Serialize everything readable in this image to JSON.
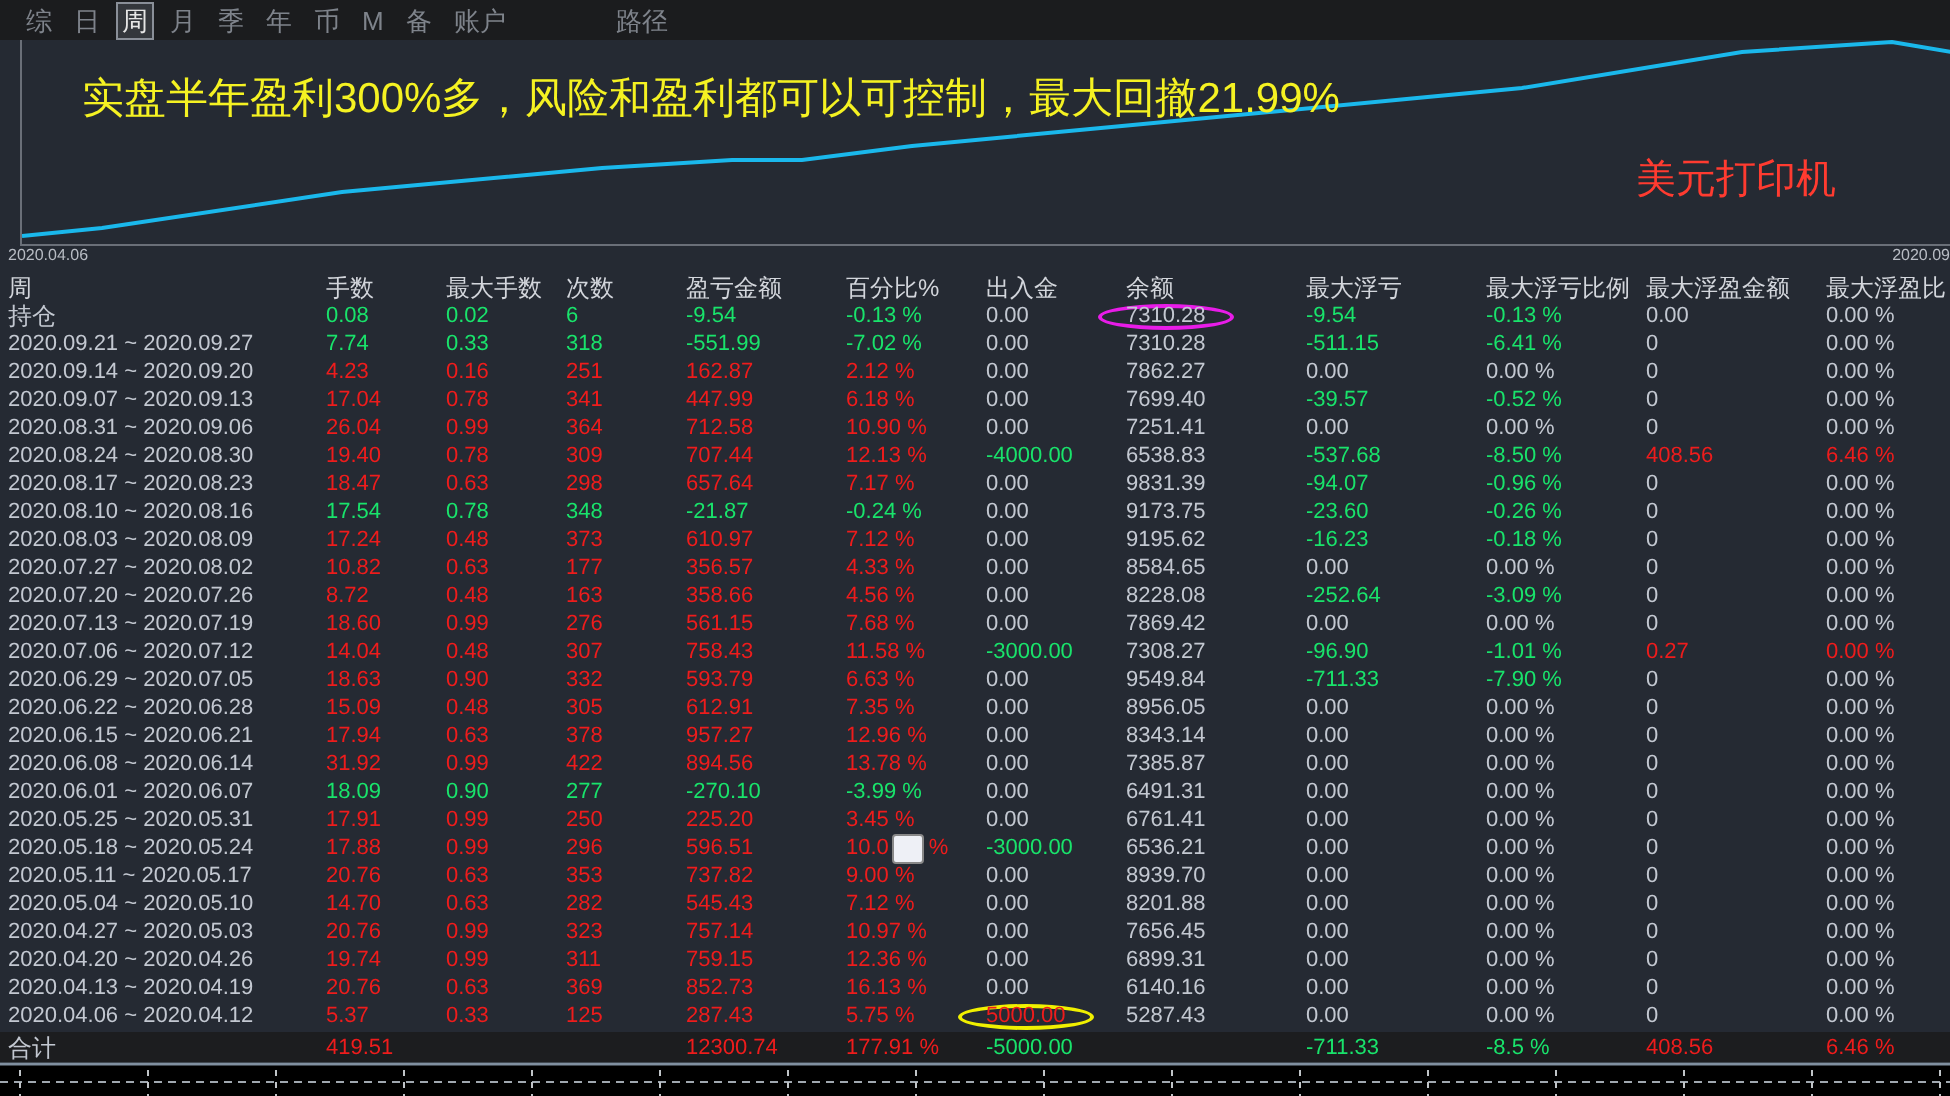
{
  "tabs": [
    {
      "label": "综",
      "selected": false
    },
    {
      "label": "日",
      "selected": false
    },
    {
      "label": "周",
      "selected": true
    },
    {
      "label": "月",
      "selected": false
    },
    {
      "label": "季",
      "selected": false
    },
    {
      "label": "年",
      "selected": false
    },
    {
      "label": "币",
      "selected": false
    },
    {
      "label": "M",
      "selected": false
    },
    {
      "label": "备",
      "selected": false
    },
    {
      "label": "账户",
      "selected": false
    },
    {
      "label": "路径",
      "selected": false
    }
  ],
  "chart": {
    "headline": "实盘半年盈利300%多，风险和盈利都可以可控制，最大回撤21.99%",
    "caption": "美元打印机",
    "start_date": "2020.04.06",
    "end_date": "2020.09"
  },
  "table": {
    "columns": [
      "周",
      "手数",
      "最大手数",
      "次数",
      "盈亏金额",
      "百分比%",
      "出入金",
      "余额",
      "最大浮亏",
      "最大浮亏比例",
      "最大浮盈金额",
      "最大浮盈比"
    ],
    "rows": [
      {
        "cells": [
          {
            "text": "持仓"
          },
          {
            "text": "0.08",
            "color": "#19e36b"
          },
          {
            "text": "0.02",
            "color": "#19e36b"
          },
          {
            "text": "6",
            "color": "#19e36b"
          },
          {
            "text": "-9.54",
            "color": "#19e36b"
          },
          {
            "text": "-0.13 %",
            "color": "#19e36b"
          },
          {
            "text": "0.00"
          },
          {
            "text": "7310.28",
            "annotation": {
              "color": "#e81ce8"
            }
          },
          {
            "text": "-9.54",
            "color": "#19e36b"
          },
          {
            "text": "-0.13 %",
            "color": "#19e36b"
          },
          {
            "text": "0.00"
          },
          {
            "text": "0.00 %"
          }
        ]
      },
      {
        "cells": [
          {
            "text": "2020.09.21 ~ 2020.09.27"
          },
          {
            "text": "7.74",
            "color": "#19e36b"
          },
          {
            "text": "0.33",
            "color": "#19e36b"
          },
          {
            "text": "318",
            "color": "#19e36b"
          },
          {
            "text": "-551.99",
            "color": "#19e36b"
          },
          {
            "text": "-7.02 %",
            "color": "#19e36b"
          },
          {
            "text": "0.00"
          },
          {
            "text": "7310.28"
          },
          {
            "text": "-511.15",
            "color": "#19e36b"
          },
          {
            "text": "-6.41 %",
            "color": "#19e36b"
          },
          {
            "text": "0"
          },
          {
            "text": "0.00 %"
          }
        ]
      },
      {
        "cells": [
          {
            "text": "2020.09.14 ~ 2020.09.20"
          },
          {
            "text": "4.23",
            "color": "#ee1c1c"
          },
          {
            "text": "0.16",
            "color": "#ee1c1c"
          },
          {
            "text": "251",
            "color": "#ee1c1c"
          },
          {
            "text": "162.87",
            "color": "#ee1c1c"
          },
          {
            "text": "2.12 %",
            "color": "#ee1c1c"
          },
          {
            "text": "0.00"
          },
          {
            "text": "7862.27"
          },
          {
            "text": "0.00"
          },
          {
            "text": "0.00 %"
          },
          {
            "text": "0"
          },
          {
            "text": "0.00 %"
          }
        ]
      },
      {
        "cells": [
          {
            "text": "2020.09.07 ~ 2020.09.13"
          },
          {
            "text": "17.04",
            "color": "#ee1c1c"
          },
          {
            "text": "0.78",
            "color": "#ee1c1c"
          },
          {
            "text": "341",
            "color": "#ee1c1c"
          },
          {
            "text": "447.99",
            "color": "#ee1c1c"
          },
          {
            "text": "6.18 %",
            "color": "#ee1c1c"
          },
          {
            "text": "0.00"
          },
          {
            "text": "7699.40"
          },
          {
            "text": "-39.57",
            "color": "#19e36b"
          },
          {
            "text": "-0.52 %",
            "color": "#19e36b"
          },
          {
            "text": "0"
          },
          {
            "text": "0.00 %"
          }
        ]
      },
      {
        "cells": [
          {
            "text": "2020.08.31 ~ 2020.09.06"
          },
          {
            "text": "26.04",
            "color": "#ee1c1c"
          },
          {
            "text": "0.99",
            "color": "#ee1c1c"
          },
          {
            "text": "364",
            "color": "#ee1c1c"
          },
          {
            "text": "712.58",
            "color": "#ee1c1c"
          },
          {
            "text": "10.90 %",
            "color": "#ee1c1c"
          },
          {
            "text": "0.00"
          },
          {
            "text": "7251.41"
          },
          {
            "text": "0.00"
          },
          {
            "text": "0.00 %"
          },
          {
            "text": "0"
          },
          {
            "text": "0.00 %"
          }
        ]
      },
      {
        "cells": [
          {
            "text": "2020.08.24 ~ 2020.08.30"
          },
          {
            "text": "19.40",
            "color": "#ee1c1c"
          },
          {
            "text": "0.78",
            "color": "#ee1c1c"
          },
          {
            "text": "309",
            "color": "#ee1c1c"
          },
          {
            "text": "707.44",
            "color": "#ee1c1c"
          },
          {
            "text": "12.13 %",
            "color": "#ee1c1c"
          },
          {
            "text": "-4000.00",
            "color": "#19e36b"
          },
          {
            "text": "6538.83"
          },
          {
            "text": "-537.68",
            "color": "#19e36b"
          },
          {
            "text": "-8.50 %",
            "color": "#19e36b"
          },
          {
            "text": "408.56",
            "color": "#ee1c1c"
          },
          {
            "text": "6.46 %",
            "color": "#ee1c1c"
          }
        ]
      },
      {
        "cells": [
          {
            "text": "2020.08.17 ~ 2020.08.23"
          },
          {
            "text": "18.47",
            "color": "#ee1c1c"
          },
          {
            "text": "0.63",
            "color": "#ee1c1c"
          },
          {
            "text": "298",
            "color": "#ee1c1c"
          },
          {
            "text": "657.64",
            "color": "#ee1c1c"
          },
          {
            "text": "7.17 %",
            "color": "#ee1c1c"
          },
          {
            "text": "0.00"
          },
          {
            "text": "9831.39"
          },
          {
            "text": "-94.07",
            "color": "#19e36b"
          },
          {
            "text": "-0.96 %",
            "color": "#19e36b"
          },
          {
            "text": "0"
          },
          {
            "text": "0.00 %"
          }
        ]
      },
      {
        "cells": [
          {
            "text": "2020.08.10 ~ 2020.08.16"
          },
          {
            "text": "17.54",
            "color": "#19e36b"
          },
          {
            "text": "0.78",
            "color": "#19e36b"
          },
          {
            "text": "348",
            "color": "#19e36b"
          },
          {
            "text": "-21.87",
            "color": "#19e36b"
          },
          {
            "text": "-0.24 %",
            "color": "#19e36b"
          },
          {
            "text": "0.00"
          },
          {
            "text": "9173.75"
          },
          {
            "text": "-23.60",
            "color": "#19e36b"
          },
          {
            "text": "-0.26 %",
            "color": "#19e36b"
          },
          {
            "text": "0"
          },
          {
            "text": "0.00 %"
          }
        ]
      },
      {
        "cells": [
          {
            "text": "2020.08.03 ~ 2020.08.09"
          },
          {
            "text": "17.24",
            "color": "#ee1c1c"
          },
          {
            "text": "0.48",
            "color": "#ee1c1c"
          },
          {
            "text": "373",
            "color": "#ee1c1c"
          },
          {
            "text": "610.97",
            "color": "#ee1c1c"
          },
          {
            "text": "7.12 %",
            "color": "#ee1c1c"
          },
          {
            "text": "0.00"
          },
          {
            "text": "9195.62"
          },
          {
            "text": "-16.23",
            "color": "#19e36b"
          },
          {
            "text": "-0.18 %",
            "color": "#19e36b"
          },
          {
            "text": "0"
          },
          {
            "text": "0.00 %"
          }
        ]
      },
      {
        "cells": [
          {
            "text": "2020.07.27 ~ 2020.08.02"
          },
          {
            "text": "10.82",
            "color": "#ee1c1c"
          },
          {
            "text": "0.63",
            "color": "#ee1c1c"
          },
          {
            "text": "177",
            "color": "#ee1c1c"
          },
          {
            "text": "356.57",
            "color": "#ee1c1c"
          },
          {
            "text": "4.33 %",
            "color": "#ee1c1c"
          },
          {
            "text": "0.00"
          },
          {
            "text": "8584.65"
          },
          {
            "text": "0.00"
          },
          {
            "text": "0.00 %"
          },
          {
            "text": "0"
          },
          {
            "text": "0.00 %"
          }
        ]
      },
      {
        "cells": [
          {
            "text": "2020.07.20 ~ 2020.07.26"
          },
          {
            "text": "8.72",
            "color": "#ee1c1c"
          },
          {
            "text": "0.48",
            "color": "#ee1c1c"
          },
          {
            "text": "163",
            "color": "#ee1c1c"
          },
          {
            "text": "358.66",
            "color": "#ee1c1c"
          },
          {
            "text": "4.56 %",
            "color": "#ee1c1c"
          },
          {
            "text": "0.00"
          },
          {
            "text": "8228.08"
          },
          {
            "text": "-252.64",
            "color": "#19e36b"
          },
          {
            "text": "-3.09 %",
            "color": "#19e36b"
          },
          {
            "text": "0"
          },
          {
            "text": "0.00 %"
          }
        ]
      },
      {
        "cells": [
          {
            "text": "2020.07.13 ~ 2020.07.19"
          },
          {
            "text": "18.60",
            "color": "#ee1c1c"
          },
          {
            "text": "0.99",
            "color": "#ee1c1c"
          },
          {
            "text": "276",
            "color": "#ee1c1c"
          },
          {
            "text": "561.15",
            "color": "#ee1c1c"
          },
          {
            "text": "7.68 %",
            "color": "#ee1c1c"
          },
          {
            "text": "0.00"
          },
          {
            "text": "7869.42"
          },
          {
            "text": "0.00"
          },
          {
            "text": "0.00 %"
          },
          {
            "text": "0"
          },
          {
            "text": "0.00 %"
          }
        ]
      },
      {
        "cells": [
          {
            "text": "2020.07.06 ~ 2020.07.12"
          },
          {
            "text": "14.04",
            "color": "#ee1c1c"
          },
          {
            "text": "0.48",
            "color": "#ee1c1c"
          },
          {
            "text": "307",
            "color": "#ee1c1c"
          },
          {
            "text": "758.43",
            "color": "#ee1c1c"
          },
          {
            "text": "11.58 %",
            "color": "#ee1c1c"
          },
          {
            "text": "-3000.00",
            "color": "#19e36b"
          },
          {
            "text": "7308.27"
          },
          {
            "text": "-96.90",
            "color": "#19e36b"
          },
          {
            "text": "-1.01 %",
            "color": "#19e36b"
          },
          {
            "text": "0.27",
            "color": "#ee1c1c"
          },
          {
            "text": "0.00 %",
            "color": "#ee1c1c"
          }
        ]
      },
      {
        "cells": [
          {
            "text": "2020.06.29 ~ 2020.07.05"
          },
          {
            "text": "18.63",
            "color": "#ee1c1c"
          },
          {
            "text": "0.90",
            "color": "#ee1c1c"
          },
          {
            "text": "332",
            "color": "#ee1c1c"
          },
          {
            "text": "593.79",
            "color": "#ee1c1c"
          },
          {
            "text": "6.63 %",
            "color": "#ee1c1c"
          },
          {
            "text": "0.00"
          },
          {
            "text": "9549.84"
          },
          {
            "text": "-711.33",
            "color": "#19e36b"
          },
          {
            "text": "-7.90 %",
            "color": "#19e36b"
          },
          {
            "text": "0"
          },
          {
            "text": "0.00 %"
          }
        ]
      },
      {
        "cells": [
          {
            "text": "2020.06.22 ~ 2020.06.28"
          },
          {
            "text": "15.09",
            "color": "#ee1c1c"
          },
          {
            "text": "0.48",
            "color": "#ee1c1c"
          },
          {
            "text": "305",
            "color": "#ee1c1c"
          },
          {
            "text": "612.91",
            "color": "#ee1c1c"
          },
          {
            "text": "7.35 %",
            "color": "#ee1c1c"
          },
          {
            "text": "0.00"
          },
          {
            "text": "8956.05"
          },
          {
            "text": "0.00"
          },
          {
            "text": "0.00 %"
          },
          {
            "text": "0"
          },
          {
            "text": "0.00 %"
          }
        ]
      },
      {
        "cells": [
          {
            "text": "2020.06.15 ~ 2020.06.21"
          },
          {
            "text": "17.94",
            "color": "#ee1c1c"
          },
          {
            "text": "0.63",
            "color": "#ee1c1c"
          },
          {
            "text": "378",
            "color": "#ee1c1c"
          },
          {
            "text": "957.27",
            "color": "#ee1c1c"
          },
          {
            "text": "12.96 %",
            "color": "#ee1c1c"
          },
          {
            "text": "0.00"
          },
          {
            "text": "8343.14"
          },
          {
            "text": "0.00"
          },
          {
            "text": "0.00 %"
          },
          {
            "text": "0"
          },
          {
            "text": "0.00 %"
          }
        ]
      },
      {
        "cells": [
          {
            "text": "2020.06.08 ~ 2020.06.14"
          },
          {
            "text": "31.92",
            "color": "#ee1c1c"
          },
          {
            "text": "0.99",
            "color": "#ee1c1c"
          },
          {
            "text": "422",
            "color": "#ee1c1c"
          },
          {
            "text": "894.56",
            "color": "#ee1c1c"
          },
          {
            "text": "13.78 %",
            "color": "#ee1c1c"
          },
          {
            "text": "0.00"
          },
          {
            "text": "7385.87"
          },
          {
            "text": "0.00"
          },
          {
            "text": "0.00 %"
          },
          {
            "text": "0"
          },
          {
            "text": "0.00 %"
          }
        ]
      },
      {
        "cells": [
          {
            "text": "2020.06.01 ~ 2020.06.07"
          },
          {
            "text": "18.09",
            "color": "#19e36b"
          },
          {
            "text": "0.90",
            "color": "#19e36b"
          },
          {
            "text": "277",
            "color": "#19e36b"
          },
          {
            "text": "-270.10",
            "color": "#19e36b"
          },
          {
            "text": "-3.99 %",
            "color": "#19e36b"
          },
          {
            "text": "0.00"
          },
          {
            "text": "6491.31"
          },
          {
            "text": "0.00"
          },
          {
            "text": "0.00 %"
          },
          {
            "text": "0"
          },
          {
            "text": "0.00 %"
          }
        ]
      },
      {
        "cells": [
          {
            "text": "2020.05.25 ~ 2020.05.31"
          },
          {
            "text": "17.91",
            "color": "#ee1c1c"
          },
          {
            "text": "0.99",
            "color": "#ee1c1c"
          },
          {
            "text": "250",
            "color": "#ee1c1c"
          },
          {
            "text": "225.20",
            "color": "#ee1c1c"
          },
          {
            "text": "3.45 %",
            "color": "#ee1c1c"
          },
          {
            "text": "0.00"
          },
          {
            "text": "6761.41"
          },
          {
            "text": "0.00"
          },
          {
            "text": "0.00 %"
          },
          {
            "text": "0"
          },
          {
            "text": "0.00 %"
          }
        ]
      },
      {
        "cells": [
          {
            "text": "2020.05.18 ~ 2020.05.24"
          },
          {
            "text": "17.88",
            "color": "#ee1c1c"
          },
          {
            "text": "0.99",
            "color": "#ee1c1c"
          },
          {
            "text": "296",
            "color": "#ee1c1c"
          },
          {
            "text": "596.51",
            "color": "#ee1c1c"
          },
          {
            "text": "10.0",
            "tail": "%",
            "color": "#ee1c1c"
          },
          {
            "text": "-3000.00",
            "color": "#19e36b"
          },
          {
            "text": "6536.21"
          },
          {
            "text": "0.00"
          },
          {
            "text": "0.00 %"
          },
          {
            "text": "0"
          },
          {
            "text": "0.00 %"
          }
        ]
      },
      {
        "cells": [
          {
            "text": "2020.05.11 ~ 2020.05.17"
          },
          {
            "text": "20.76",
            "color": "#ee1c1c"
          },
          {
            "text": "0.63",
            "color": "#ee1c1c"
          },
          {
            "text": "353",
            "color": "#ee1c1c"
          },
          {
            "text": "737.82",
            "color": "#ee1c1c"
          },
          {
            "text": "9.00 %",
            "color": "#ee1c1c"
          },
          {
            "text": "0.00"
          },
          {
            "text": "8939.70"
          },
          {
            "text": "0.00"
          },
          {
            "text": "0.00 %"
          },
          {
            "text": "0"
          },
          {
            "text": "0.00 %"
          }
        ]
      },
      {
        "cells": [
          {
            "text": "2020.05.04 ~ 2020.05.10"
          },
          {
            "text": "14.70",
            "color": "#ee1c1c"
          },
          {
            "text": "0.63",
            "color": "#ee1c1c"
          },
          {
            "text": "282",
            "color": "#ee1c1c"
          },
          {
            "text": "545.43",
            "color": "#ee1c1c"
          },
          {
            "text": "7.12 %",
            "color": "#ee1c1c"
          },
          {
            "text": "0.00"
          },
          {
            "text": "8201.88"
          },
          {
            "text": "0.00"
          },
          {
            "text": "0.00 %"
          },
          {
            "text": "0"
          },
          {
            "text": "0.00 %"
          }
        ]
      },
      {
        "cells": [
          {
            "text": "2020.04.27 ~ 2020.05.03"
          },
          {
            "text": "20.76",
            "color": "#ee1c1c"
          },
          {
            "text": "0.99",
            "color": "#ee1c1c"
          },
          {
            "text": "323",
            "color": "#ee1c1c"
          },
          {
            "text": "757.14",
            "color": "#ee1c1c"
          },
          {
            "text": "10.97 %",
            "color": "#ee1c1c"
          },
          {
            "text": "0.00"
          },
          {
            "text": "7656.45"
          },
          {
            "text": "0.00"
          },
          {
            "text": "0.00 %"
          },
          {
            "text": "0"
          },
          {
            "text": "0.00 %"
          }
        ]
      },
      {
        "cells": [
          {
            "text": "2020.04.20 ~ 2020.04.26"
          },
          {
            "text": "19.74",
            "color": "#ee1c1c"
          },
          {
            "text": "0.99",
            "color": "#ee1c1c"
          },
          {
            "text": "311",
            "color": "#ee1c1c"
          },
          {
            "text": "759.15",
            "color": "#ee1c1c"
          },
          {
            "text": "12.36 %",
            "color": "#ee1c1c"
          },
          {
            "text": "0.00"
          },
          {
            "text": "6899.31"
          },
          {
            "text": "0.00"
          },
          {
            "text": "0.00 %"
          },
          {
            "text": "0"
          },
          {
            "text": "0.00 %"
          }
        ]
      },
      {
        "cells": [
          {
            "text": "2020.04.13 ~ 2020.04.19"
          },
          {
            "text": "20.76",
            "color": "#ee1c1c"
          },
          {
            "text": "0.63",
            "color": "#ee1c1c"
          },
          {
            "text": "369",
            "color": "#ee1c1c"
          },
          {
            "text": "852.73",
            "color": "#ee1c1c"
          },
          {
            "text": "16.13 %",
            "color": "#ee1c1c"
          },
          {
            "text": "0.00"
          },
          {
            "text": "6140.16"
          },
          {
            "text": "0.00"
          },
          {
            "text": "0.00 %"
          },
          {
            "text": "0"
          },
          {
            "text": "0.00 %"
          }
        ]
      },
      {
        "cells": [
          {
            "text": "2020.04.06 ~ 2020.04.12"
          },
          {
            "text": "5.37",
            "color": "#ee1c1c"
          },
          {
            "text": "0.33",
            "color": "#ee1c1c"
          },
          {
            "text": "125",
            "color": "#ee1c1c"
          },
          {
            "text": "287.43",
            "color": "#ee1c1c"
          },
          {
            "text": "5.75 %",
            "color": "#ee1c1c"
          },
          {
            "text": "5000.00",
            "color": "#ee1c1c",
            "annotation": {
              "color": "#f0f000"
            }
          },
          {
            "text": "5287.43"
          },
          {
            "text": "0.00"
          },
          {
            "text": "0.00 %"
          },
          {
            "text": "0"
          },
          {
            "text": "0.00 %"
          }
        ]
      }
    ],
    "total": {
      "cells": [
        {
          "text": "合计"
        },
        {
          "text": "419.51",
          "color": "#ee1c1c"
        },
        null,
        null,
        {
          "text": "12300.74",
          "color": "#ee1c1c"
        },
        {
          "text": "177.91 %",
          "color": "#ee1c1c"
        },
        {
          "text": "-5000.00",
          "color": "#19e36b"
        },
        null,
        {
          "text": "-711.33",
          "color": "#19e36b"
        },
        {
          "text": "-8.5 %",
          "color": "#19e36b"
        },
        {
          "text": "408.56",
          "color": "#ee1c1c"
        },
        {
          "text": "6.46 %",
          "color": "#ee1c1c"
        }
      ]
    }
  }
}
